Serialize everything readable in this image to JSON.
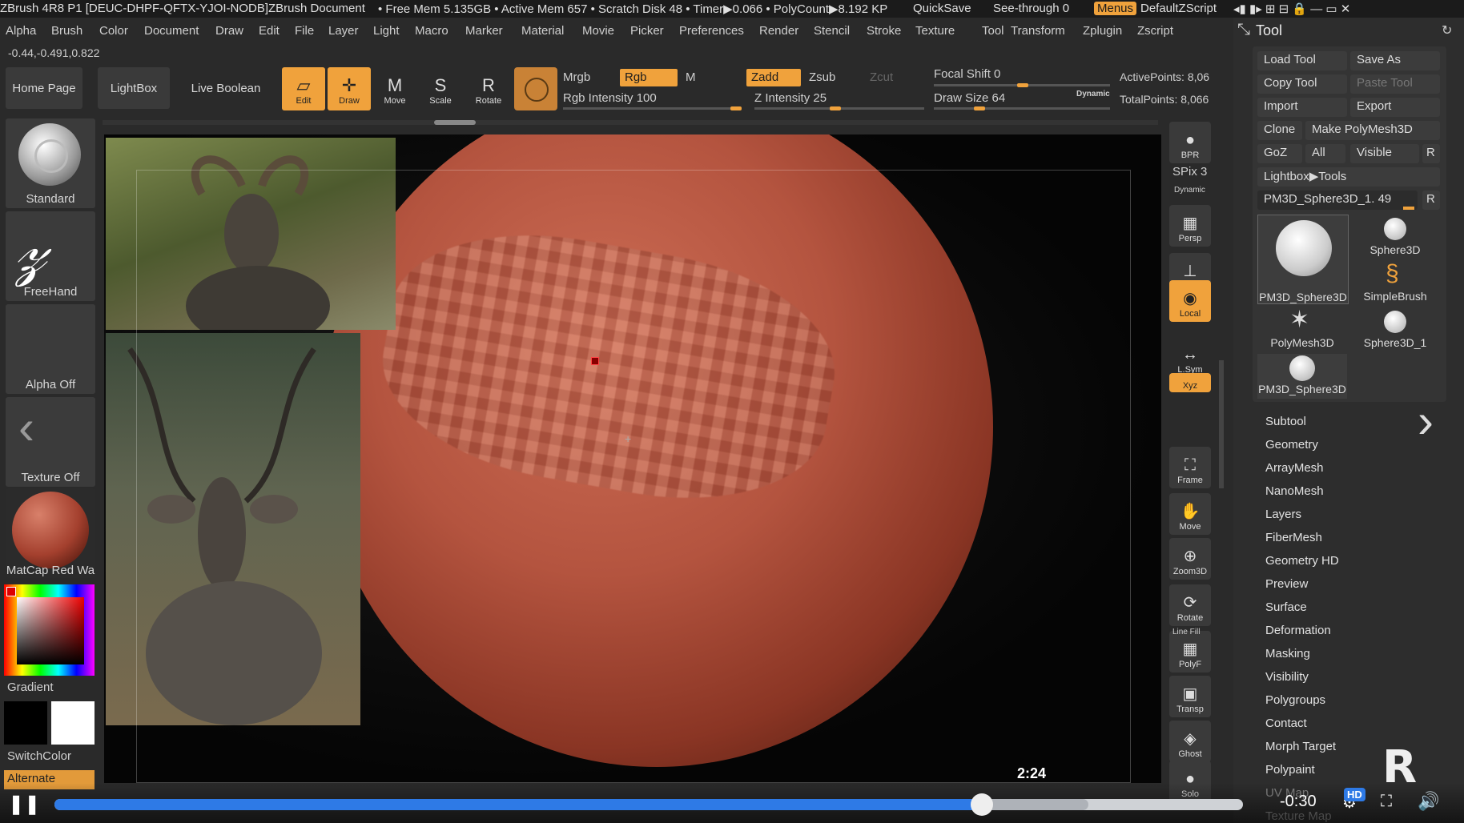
{
  "titlebar": {
    "app_title": "ZBrush 4R8 P1 [DEUC-DHPF-QFTX-YJOI-NODB]",
    "document": "ZBrush Document",
    "stats": "• Free Mem 5.135GB • Active Mem 657 • Scratch Disk 48 • Timer▶0.066 • PolyCount▶8.192 KP",
    "quicksave": "QuickSave",
    "see_through": "See-through  0",
    "menus": "Menus",
    "default_zscript": "DefaultZScript"
  },
  "menubar": [
    "Alpha",
    "Brush",
    "Color",
    "Document",
    "Draw",
    "Edit",
    "File",
    "Layer",
    "Light",
    "Macro",
    "Marker",
    "Material",
    "Movie",
    "Picker",
    "Preferences",
    "Render",
    "Stencil",
    "Stroke",
    "Texture",
    "Tool",
    "Transform",
    "Zplugin",
    "Zscript"
  ],
  "coords": "-0.44,-0.491,0.822",
  "shelf": {
    "home_page": "Home Page",
    "lightbox": "LightBox",
    "live_boolean": "Live Boolean",
    "tools": [
      {
        "label": "Edit",
        "icon": "▱"
      },
      {
        "label": "Draw",
        "icon": "✛"
      },
      {
        "label": "Move",
        "icon": "M"
      },
      {
        "label": "Scale",
        "icon": "S"
      },
      {
        "label": "Rotate",
        "icon": "R"
      }
    ],
    "mrgb": "Mrgb",
    "rgb": "Rgb",
    "m": "M",
    "rgb_intensity": "Rgb Intensity 100",
    "zadd": "Zadd",
    "zsub": "Zsub",
    "zcut": "Zcut",
    "z_intensity": "Z Intensity 25",
    "focal_shift": "Focal Shift 0",
    "draw_size": "Draw Size 64",
    "dynamic": "Dynamic",
    "active_points": "ActivePoints: 8,06",
    "total_points": "TotalPoints: 8,066"
  },
  "left_shelf": {
    "brush": "Standard",
    "stroke": "FreeHand",
    "alpha": "Alpha Off",
    "texture": "Texture Off",
    "material": "MatCap Red Wa",
    "gradient": "Gradient",
    "switch_color": "SwitchColor",
    "alternate": "Alternate"
  },
  "right_shelf": [
    {
      "label": "BPR",
      "icon": "●"
    },
    {
      "label": "SPix 3",
      "icon": ""
    },
    {
      "label": "Persp",
      "icon": "▦"
    },
    {
      "label": "Floor",
      "icon": "⊥"
    },
    {
      "label": "Local",
      "icon": "◉"
    },
    {
      "label": "L.Sym",
      "icon": "↔"
    },
    {
      "label": "Xyz",
      "icon": "⟲"
    },
    {
      "label": "Frame",
      "icon": "⛶"
    },
    {
      "label": "Move",
      "icon": "✋"
    },
    {
      "label": "Zoom3D",
      "icon": "⊕"
    },
    {
      "label": "Rotate",
      "icon": "⟳"
    },
    {
      "label": "PolyF",
      "icon": "▦"
    },
    {
      "label": "Transp",
      "icon": "▣"
    },
    {
      "label": "Ghost",
      "icon": "◈"
    },
    {
      "label": "Solo",
      "icon": "●"
    }
  ],
  "right_shelf_extra": {
    "dynamic": "Dynamic",
    "line_fill": "Line Fill"
  },
  "tool_panel": {
    "title": "Tool",
    "buttons": {
      "load_tool": "Load Tool",
      "save_as": "Save As",
      "copy_tool": "Copy Tool",
      "paste_tool": "Paste Tool",
      "import": "Import",
      "export": "Export",
      "clone": "Clone",
      "make_polymesh": "Make PolyMesh3D",
      "goz": "GoZ",
      "all": "All",
      "visible": "Visible",
      "r": "R",
      "lightbox_tools": "Lightbox▶Tools"
    },
    "current_tool": "PM3D_Sphere3D_1. 49",
    "current_tool_r": "R",
    "thumbs": [
      "PM3D_Sphere3D",
      "Sphere3D",
      "SimpleBrush",
      "PolyMesh3D",
      "Sphere3D_1",
      "PM3D_Sphere3D"
    ],
    "subpalettes": [
      "Subtool",
      "Geometry",
      "ArrayMesh",
      "NanoMesh",
      "Layers",
      "FiberMesh",
      "Geometry HD",
      "Preview",
      "Surface",
      "Deformation",
      "Masking",
      "Visibility",
      "Polygroups",
      "Contact",
      "Morph Target",
      "Polypaint",
      "UV Map",
      "Texture Map"
    ]
  },
  "video": {
    "time_tooltip": "2:24",
    "remaining": "-0:30",
    "hd": "HD",
    "progress": 0.78,
    "buffered": 0.87
  },
  "colors": {
    "accent": "#f0a23c",
    "sphere": "#b4543f",
    "progress": "#2e7ae6"
  }
}
